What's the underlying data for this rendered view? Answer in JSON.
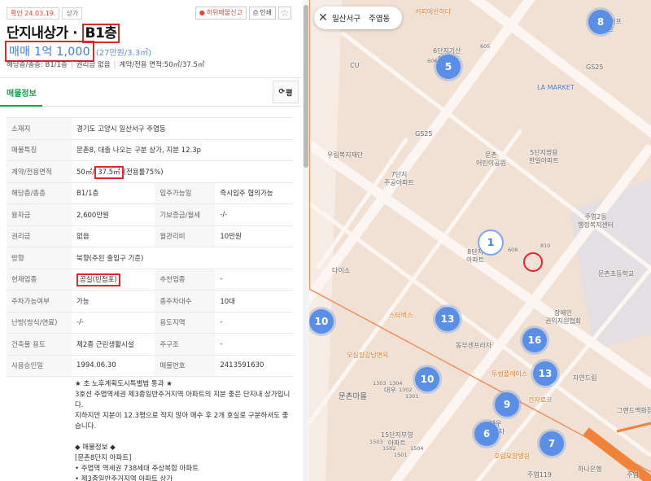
{
  "badges": {
    "confirm": "확인 24.03.19.",
    "type": "상가"
  },
  "actions": {
    "report": "허위매물신고",
    "print": "인쇄"
  },
  "title": {
    "name": "단지내상가",
    "floor": "B1층"
  },
  "price": {
    "main": "매매 1억 1,000",
    "sub": "(27만원/3.3㎡)"
  },
  "summary": {
    "floor": "해당층/총층: B1/1층",
    "rights": "권리금 없음",
    "area": "계약/전용 면적:50㎡/37.5㎡"
  },
  "tabs": {
    "active": "매물정보",
    "refresh": "평"
  },
  "rows": [
    {
      "k": "소재지",
      "v": "경기도 고양시 일산서구 주엽동"
    },
    {
      "k": "매물특징",
      "v": "문촌8, 대출 나오는 구분 상가, 지분 12.3p"
    },
    {
      "k": "계약/전용면적",
      "v_pre": "50㎡/",
      "v_hl": "37.5㎡",
      "v_post": "(전용률75%)"
    },
    {
      "k": "해당층/총층",
      "v": "B1/1층",
      "k2": "입주가능일",
      "v2": "즉시입주 협의가능"
    },
    {
      "k": "융자금",
      "v": "2,600만원",
      "k2": "기보증금/월세",
      "v2": "-/-"
    },
    {
      "k": "권리금",
      "v": "없음",
      "k2": "월관리비",
      "v2": "10만원"
    },
    {
      "k": "방향",
      "v": "북향(주된 출입구 기준)"
    },
    {
      "k": "현재업종",
      "v": "공실(빈점포)",
      "k2": "추천업종",
      "v2": "-"
    },
    {
      "k": "주차가능여부",
      "v": "가능",
      "k2": "총주차대수",
      "v2": "10대"
    },
    {
      "k": "난방(방식/연료)",
      "v": "-/-",
      "k2": "용도지역",
      "v2": "-"
    },
    {
      "k": "건축물 용도",
      "v": "제2종 근린생활시설",
      "k2": "주구조",
      "v2": "-"
    },
    {
      "k": "사용승인일",
      "v": "1994.06.30",
      "k2": "매물번호",
      "v2": "2413591630"
    }
  ],
  "desc": [
    "★ 초 노후계획도시특별법 통과 ★",
    "3호선 주엽역세권 제3종일반주거지역 아파트의 지분 좋은 단지내 상가입니다.",
    "지하지만 지분이 12.3평으로 작지 않아 매수 후 2개 호실로 구분하셔도 좋습니다.",
    "",
    "◆ 매물정보 ◆",
    "[문촌8단지 아파트]",
    "• 주엽역 역세권 738세대 주상복합 아파트",
    "• 제3종일반주거지역 아파트 상가"
  ],
  "map": {
    "search": {
      "district": "일산서구",
      "dong": "주엽동"
    },
    "labels": [
      {
        "t": "커피에반하다",
        "c": "orange"
      },
      {
        "t": "6단지기산\n아파트"
      },
      {
        "t": "7단지라이프\n아파트"
      },
      {
        "t": "LA MARKET",
        "c": "blue"
      },
      {
        "t": "GS25"
      },
      {
        "t": "CU"
      },
      {
        "t": "GS25"
      },
      {
        "t": "우림복지재단"
      },
      {
        "t": "문촌\n어린이공원"
      },
      {
        "t": "5단지쌍용\n한일아파트"
      },
      {
        "t": "7단지\n주공아파트"
      },
      {
        "t": "주엽2동\n행정복지센터"
      },
      {
        "t": "다이소"
      },
      {
        "t": "8단지\n아파트"
      },
      {
        "t": "문촌초등학교"
      },
      {
        "t": "스타벅스",
        "c": "orange"
      },
      {
        "t": "장애인\n권익지원협회"
      },
      {
        "t": "동부센프라자"
      },
      {
        "t": "오실장감남면옥",
        "c": "orange"
      },
      {
        "t": "투썸플레이스",
        "c": "orange"
      },
      {
        "t": "자연드림"
      },
      {
        "t": "문촌마을",
        "c": "bold"
      },
      {
        "t": "대우"
      },
      {
        "t": "긴자료코",
        "c": "orange"
      },
      {
        "t": "15단지부영\n아파트"
      },
      {
        "t": "대우\n프라자"
      },
      {
        "t": "그랜드백화점"
      },
      {
        "t": "호림요양병원",
        "c": "orange"
      },
      {
        "t": "주엽119"
      },
      {
        "t": "하나은행"
      },
      {
        "t": "주엽"
      }
    ],
    "clusters": [
      "8",
      "5",
      "1",
      "10",
      "13",
      "16",
      "13",
      "10",
      "9",
      "6",
      "7"
    ],
    "numbers": [
      "606",
      "605",
      "608",
      "810",
      "1303",
      "1304",
      "1302",
      "1301",
      "1503",
      "1502",
      "1501",
      "1504"
    ]
  }
}
